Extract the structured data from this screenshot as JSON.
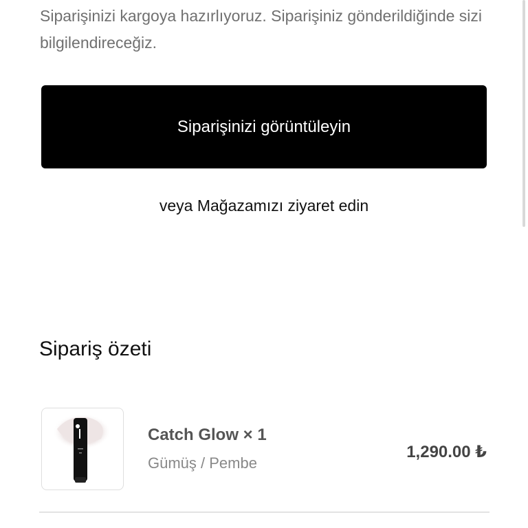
{
  "status": {
    "message": "Siparişinizi kargoya hazırlıyoruz. Siparişiniz gönderildiğinde sizi bilgilendireceğiz."
  },
  "actions": {
    "view_order_label": "Siparişinizi görüntüleyin",
    "or_text": "veya",
    "visit_store_label": "Mağazamızı ziyaret edin"
  },
  "order_summary": {
    "title": "Sipariş özeti",
    "items": [
      {
        "name": "Catch Glow × 1",
        "variant": "Gümüş / Pembe",
        "price": "1,290.00 ₺",
        "icon": "product-tube-image"
      }
    ]
  },
  "colors": {
    "button_bg": "#000000",
    "button_text": "#ffffff",
    "muted_text": "#707070"
  }
}
